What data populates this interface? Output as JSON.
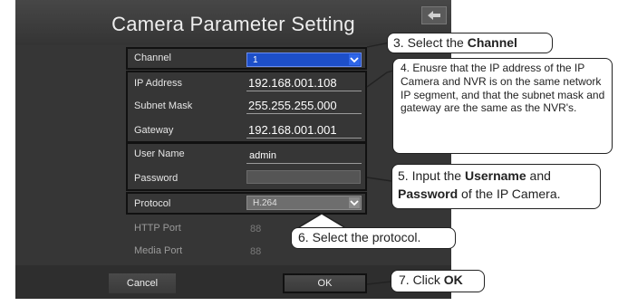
{
  "window": {
    "title": "Camera Parameter Setting"
  },
  "form": {
    "channel": {
      "label": "Channel",
      "value": "1"
    },
    "ip_address": {
      "label": "IP Address",
      "value": "192.168.001.108"
    },
    "subnet_mask": {
      "label": "Subnet Mask",
      "value": "255.255.255.000"
    },
    "gateway": {
      "label": "Gateway",
      "value": "192.168.001.001"
    },
    "user_name": {
      "label": "User Name",
      "value": "admin"
    },
    "password": {
      "label": "Password",
      "value": ""
    },
    "protocol": {
      "label": "Protocol",
      "value": "H.264"
    },
    "http_port": {
      "label": "HTTP Port",
      "value": "88"
    },
    "media_port": {
      "label": "Media Port",
      "value": "88"
    }
  },
  "buttons": {
    "cancel": "Cancel",
    "ok": "OK"
  },
  "callouts": {
    "c3": {
      "pre": "3. Select the ",
      "bold": "Channel"
    },
    "c4": {
      "text": "4. Enusre that the IP address of the IP Camera and NVR is on the same network IP segment, and that the subnet mask and gateway are the same as the NVR's."
    },
    "c5": {
      "pre": "5. Input the ",
      "bold1": "Username",
      "mid": " and ",
      "bold2": "Password",
      "post": " of the IP Camera."
    },
    "c6": {
      "text": "6. Select the protocol."
    },
    "c7": {
      "pre": "7. Click ",
      "bold": "OK"
    }
  },
  "colors": {
    "panel": "#3c3c3c",
    "select_blue": "#1d4fc9",
    "select_gray": "#6e6e6e"
  }
}
